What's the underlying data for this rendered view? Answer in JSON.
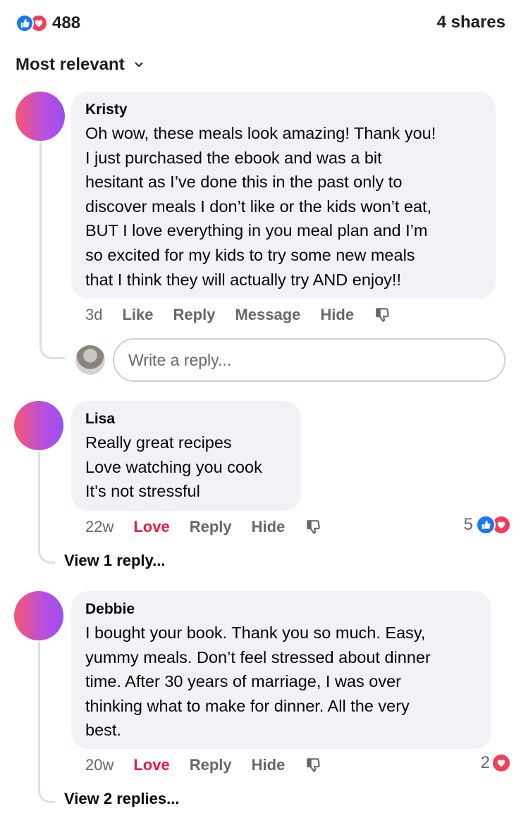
{
  "post_stats": {
    "reaction_count": "488",
    "shares": "4 shares"
  },
  "sort": {
    "label": "Most relevant"
  },
  "comments": [
    {
      "author": "Kristy",
      "lines": [
        "Oh wow, these meals look amazing! Thank you!",
        "I just purchased the ebook and was a bit",
        "hesitant as I’ve done this in the past only to",
        "discover meals I don’t like or the kids won’t eat,",
        "BUT I love everything in you meal plan and I’m",
        "so excited for my kids to try some new meals",
        "that I think they will actually try AND enjoy!!"
      ],
      "time": "3d",
      "actions": [
        "Like",
        "Reply",
        "Message",
        "Hide"
      ],
      "reply_placeholder": "Write a reply..."
    },
    {
      "author": "Lisa",
      "lines": [
        "Really great recipes",
        "Love watching you cook",
        "It’s not stressful"
      ],
      "time": "22w",
      "reaction_label": "Love",
      "actions": [
        "Reply",
        "Hide"
      ],
      "reaction_count": "5",
      "view_replies": "View 1 reply..."
    },
    {
      "author": "Debbie",
      "lines": [
        "I bought your book. Thank you so much. Easy,",
        "yummy meals. Don’t feel stressed about dinner",
        "time. After 30 years of marriage, I was over",
        "thinking what to make for dinner. All the very",
        "best."
      ],
      "time": "20w",
      "reaction_label": "Love",
      "actions": [
        "Reply",
        "Hide"
      ],
      "reaction_count": "2",
      "view_replies": "View 2 replies..."
    }
  ],
  "colors": {
    "like_blue": "#1877f2",
    "love_red": "#f33e58",
    "love_text": "#e41e3f",
    "bubble": "#f0f2f5",
    "secondary_text": "#65676b"
  },
  "icons": [
    "like-icon",
    "love-icon",
    "chevron-down-icon",
    "dislike-icon"
  ]
}
